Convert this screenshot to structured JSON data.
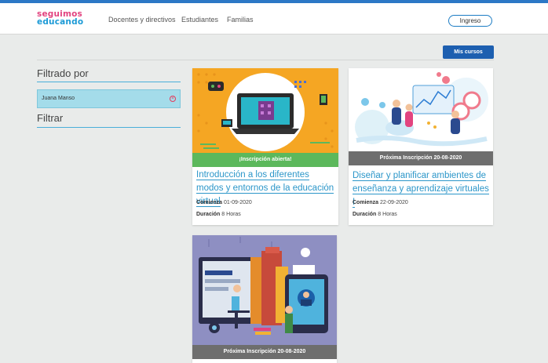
{
  "header": {
    "logo_line1": "seguimos",
    "logo_line2": "educando",
    "nav": [
      "Docentes y directivos",
      "Estudiantes",
      "Familias"
    ],
    "login_label": "Ingreso"
  },
  "toolbar": {
    "my_courses_label": "Mis cursos"
  },
  "sidebar": {
    "filtered_by_label": "Filtrado por",
    "active_filter": "Juana Manso",
    "filter_label": "Filtrar"
  },
  "courses": [
    {
      "status": "¡Inscripción abierta!",
      "status_color": "#5cb85c",
      "title": "Introducción a los diferentes modos y entornos de la educación virtual",
      "starts_label": "Comienza",
      "starts": "01-09-2020",
      "duration_label": "Duración",
      "duration": "8 Horas"
    },
    {
      "status": "Próxima Inscripción 20-08-2020",
      "status_color": "#6e6e6e",
      "title": "Diseñar y planificar ambientes de enseñanza y aprendizaje virtuales I",
      "starts_label": "Comienza",
      "starts": "22-09-2020",
      "duration_label": "Duración",
      "duration": "8 Horas"
    },
    {
      "status": "Próxima Inscripción 20-08-2020",
      "status_color": "#6e6e6e"
    }
  ],
  "colors": {
    "accent": "#2c78c6",
    "button": "#1d5fb0",
    "link": "#2b96c9",
    "chip": "#a4dcea"
  }
}
